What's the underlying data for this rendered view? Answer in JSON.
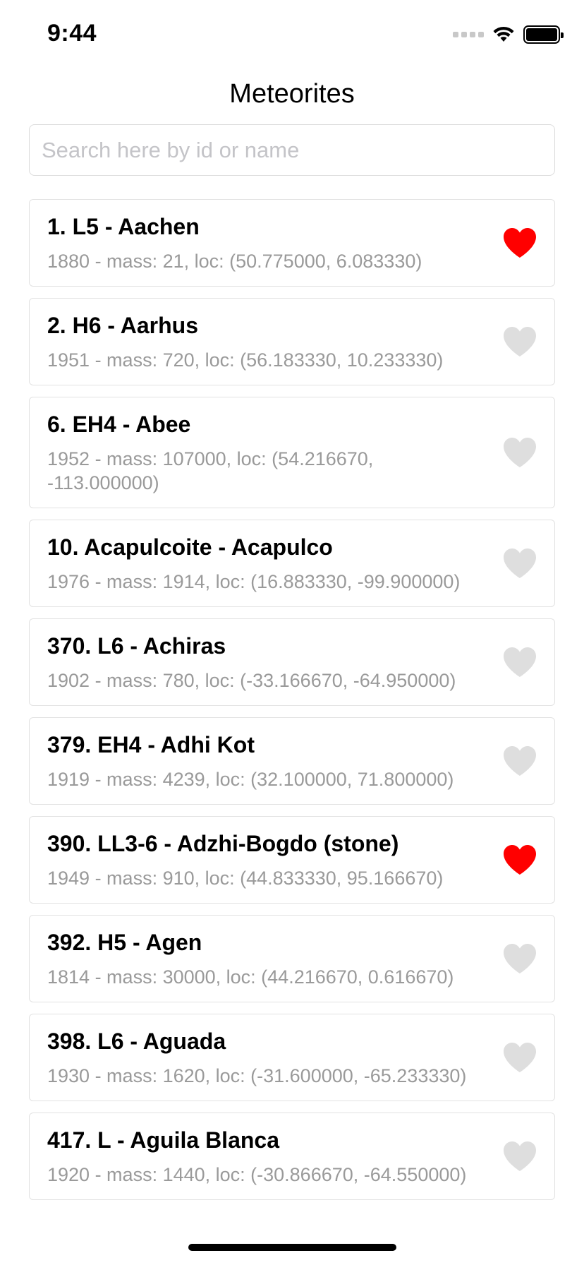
{
  "status_bar": {
    "time": "9:44"
  },
  "nav": {
    "title": "Meteorites"
  },
  "search": {
    "placeholder": "Search here by id or name",
    "value": ""
  },
  "colors": {
    "favorite_on": "#ff0000",
    "favorite_off": "#dedede",
    "subtitle": "#9a9a9a"
  },
  "meteorites": [
    {
      "title": "1. L5 - Aachen",
      "subtitle": "1880 - mass: 21, loc: (50.775000, 6.083330)",
      "favorite": true
    },
    {
      "title": "2. H6 - Aarhus",
      "subtitle": "1951 - mass: 720, loc: (56.183330, 10.233330)",
      "favorite": false
    },
    {
      "title": "6. EH4 - Abee",
      "subtitle": "1952 - mass: 107000, loc: (54.216670, -113.000000)",
      "favorite": false
    },
    {
      "title": "10. Acapulcoite - Acapulco",
      "subtitle": "1976 - mass: 1914, loc: (16.883330, -99.900000)",
      "favorite": false
    },
    {
      "title": "370. L6 - Achiras",
      "subtitle": "1902 - mass: 780, loc: (-33.166670, -64.950000)",
      "favorite": false
    },
    {
      "title": "379. EH4 - Adhi Kot",
      "subtitle": "1919 - mass: 4239, loc: (32.100000, 71.800000)",
      "favorite": false
    },
    {
      "title": "390. LL3-6 - Adzhi-Bogdo (stone)",
      "subtitle": "1949 - mass: 910, loc: (44.833330, 95.166670)",
      "favorite": true
    },
    {
      "title": "392. H5 - Agen",
      "subtitle": "1814 - mass: 30000, loc: (44.216670, 0.616670)",
      "favorite": false
    },
    {
      "title": "398. L6 - Aguada",
      "subtitle": "1930 - mass: 1620, loc: (-31.600000, -65.233330)",
      "favorite": false
    },
    {
      "title": "417. L - Aguila Blanca",
      "subtitle": "1920 - mass: 1440, loc: (-30.866670, -64.550000)",
      "favorite": false
    }
  ]
}
